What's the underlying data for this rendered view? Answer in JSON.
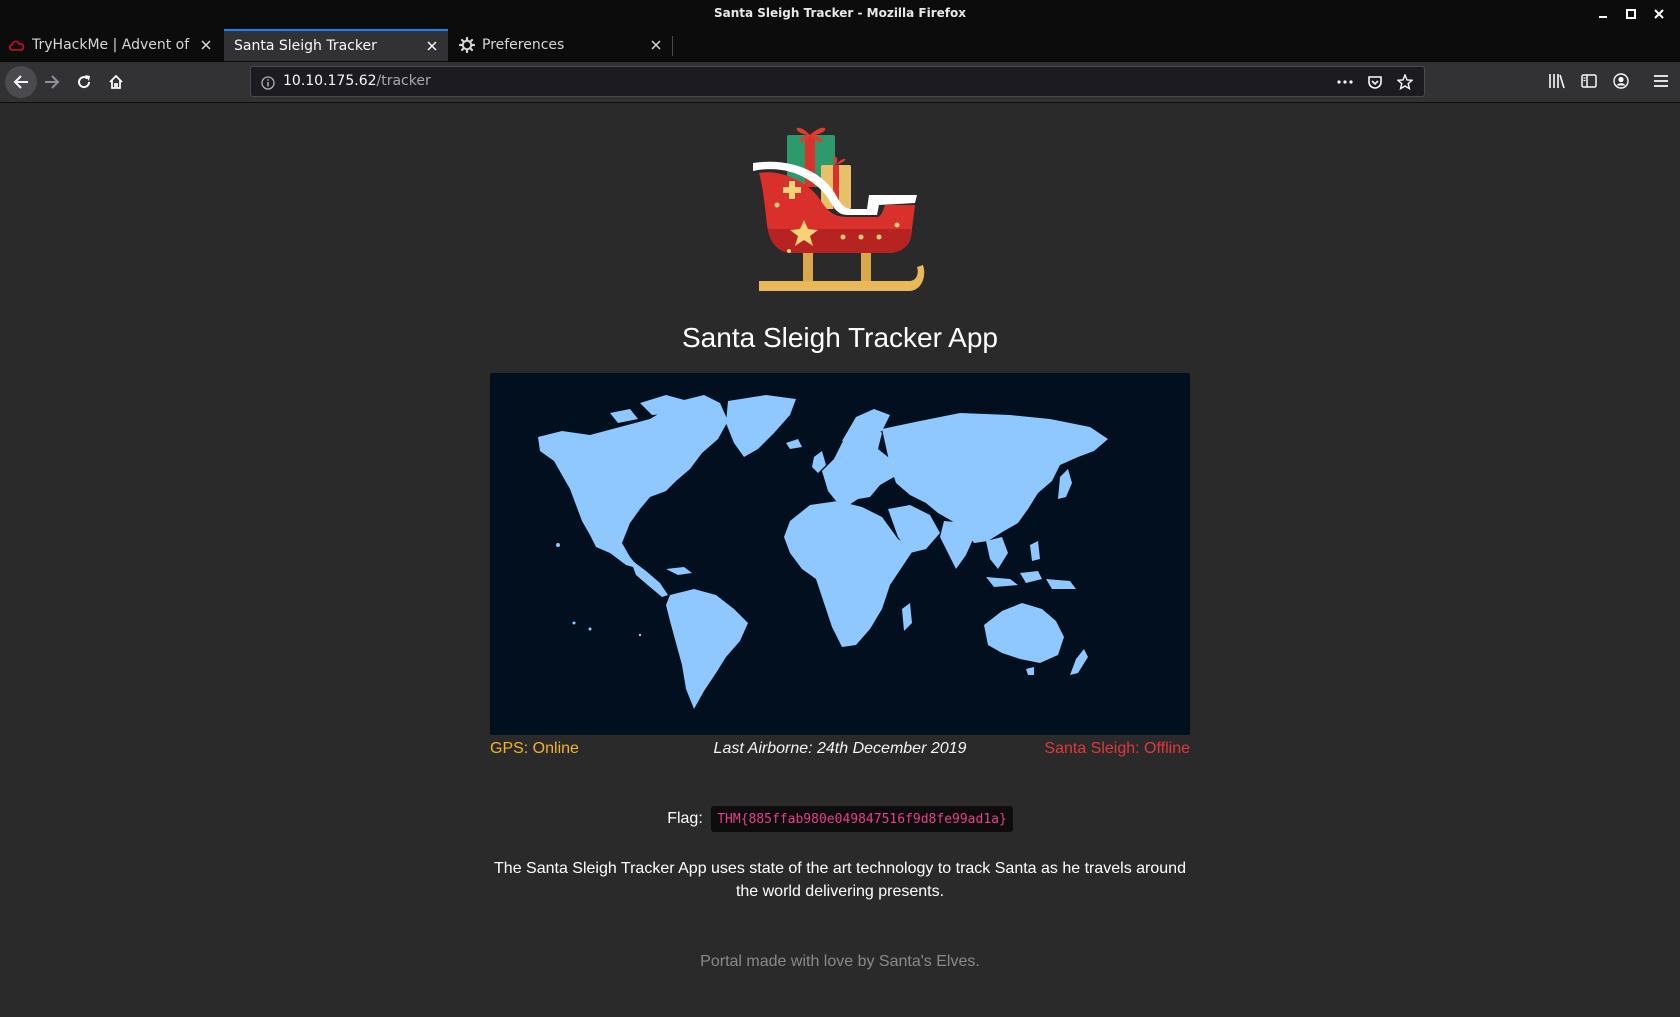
{
  "window": {
    "title": "Santa Sleigh Tracker - Mozilla Firefox"
  },
  "tabs": [
    {
      "label": "TryHackMe | Advent of C",
      "icon": "tryhackme-favicon",
      "active": false
    },
    {
      "label": "Santa Sleigh Tracker",
      "icon": "none",
      "active": true
    },
    {
      "label": "Preferences",
      "icon": "gear-icon",
      "active": false
    }
  ],
  "navbar": {
    "url_host": "10.10.175.62",
    "url_path": "/tracker"
  },
  "page": {
    "title": "Santa Sleigh Tracker App",
    "gps_status": "GPS: Online",
    "last_airborne": "Last Airborne: 24th December 2019",
    "sleigh_status": "Santa Sleigh: Offline",
    "flag_label": "Flag:",
    "flag_value": "THM{885ffab980e049847516f9d8fe99ad1a}",
    "description": "The Santa Sleigh Tracker App uses state of the art technology to track Santa as he travels around the world delivering presents.",
    "footer": "Portal made with love by Santa's Elves."
  },
  "colors": {
    "gps_online": "#f0b32b",
    "sleigh_offline": "#e0383c",
    "flag_code": "#e83e8c",
    "map_land": "#8ec8ff",
    "map_sea": "#020f1f",
    "tab_accent": "#0a84ff"
  }
}
